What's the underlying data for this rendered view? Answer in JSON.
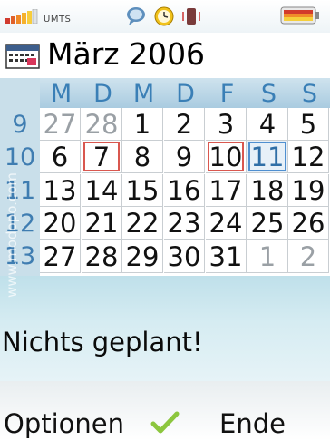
{
  "status": {
    "network": "UMTS",
    "icons": [
      "signal-icon",
      "chat-icon",
      "alarm-clock-icon",
      "vibrate-icon",
      "battery-icon"
    ]
  },
  "calendar": {
    "title": "März 2006",
    "weekdays": [
      "M",
      "D",
      "M",
      "D",
      "F",
      "S",
      "S"
    ],
    "weeks": [
      {
        "num": "9",
        "days": [
          "27",
          "28",
          "1",
          "2",
          "3",
          "4",
          "5"
        ]
      },
      {
        "num": "10",
        "days": [
          "6",
          "7",
          "8",
          "9",
          "10",
          "11",
          "12"
        ]
      },
      {
        "num": "11",
        "days": [
          "13",
          "14",
          "15",
          "16",
          "17",
          "18",
          "19"
        ]
      },
      {
        "num": "12",
        "days": [
          "20",
          "21",
          "22",
          "23",
          "24",
          "25",
          "26"
        ]
      },
      {
        "num": "13",
        "days": [
          "27",
          "28",
          "29",
          "30",
          "31",
          "1",
          "2"
        ]
      }
    ],
    "today": "11",
    "marked_days": [
      "7",
      "10"
    ]
  },
  "agenda": {
    "message": "Nichts geplant!"
  },
  "softkeys": {
    "left": "Optionen",
    "right": "Ende"
  },
  "watermark": "www.modopo.com",
  "colors": {
    "accent": "#3a7fb6",
    "marker": "#d9574f",
    "today_border": "#4f8fd0",
    "panel": "#c9dfea"
  }
}
